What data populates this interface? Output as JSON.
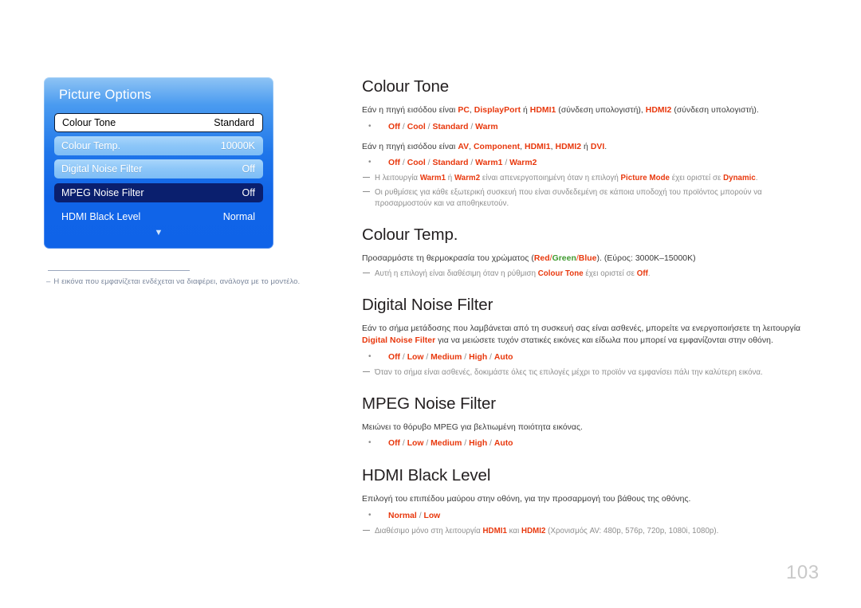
{
  "osd": {
    "title": "Picture Options",
    "scroll_down_icon": "chevron-down-icon",
    "rows": [
      {
        "label": "Colour Tone",
        "value": "Standard",
        "state": "selected"
      },
      {
        "label": "Colour Temp.",
        "value": "10000K",
        "state": "light"
      },
      {
        "label": "Digital Noise Filter",
        "value": "Off",
        "state": "light"
      },
      {
        "label": "MPEG Noise Filter",
        "value": "Off",
        "state": "dark"
      },
      {
        "label": "HDMI Black Level",
        "value": "Normal",
        "state": "plain"
      }
    ],
    "footnote_dash": "–",
    "footnote": "Η εικόνα που εμφανίζεται ενδέχεται να διαφέρει, ανάλογα με το μοντέλο."
  },
  "sections": {
    "colour_tone": {
      "title": "Colour Tone",
      "p1_a": "Εάν η πηγή εισόδου είναι ",
      "p1_pc": "PC",
      "p1_b": ", ",
      "p1_dp": "DisplayPort",
      "p1_c": " ή ",
      "p1_hdmi1": "HDMI1",
      "p1_d": " (σύνδεση υπολογιστή), ",
      "p1_hdmi2": "HDMI2",
      "p1_e": " (σύνδεση υπολογιστή).",
      "opts1": [
        "Off",
        "Cool",
        "Standard",
        "Warm"
      ],
      "p2_a": "Εάν η πηγή εισόδου είναι ",
      "p2_av": "AV",
      "p2_b": ", ",
      "p2_component": "Component",
      "p2_c": ", ",
      "p2_hdmi1": "HDMI1",
      "p2_d": ", ",
      "p2_hdmi2": "HDMI2",
      "p2_e": "  ή ",
      "p2_dvi": "DVI",
      "p2_f": ".",
      "opts2": [
        "Off",
        "Cool",
        "Standard",
        "Warm1",
        "Warm2"
      ],
      "note1_a": "Η λειτουργία ",
      "note1_warm1": "Warm1",
      "note1_b": " ή ",
      "note1_warm2": "Warm2",
      "note1_c": " είναι απενεργοποιημένη όταν η επιλογή ",
      "note1_pm": "Picture Mode",
      "note1_d": " έχει οριστεί σε ",
      "note1_dynamic": "Dynamic",
      "note1_e": ".",
      "note2": "Οι ρυθμίσεις για κάθε εξωτερική συσκευή που είναι συνδεδεμένη σε κάποια υποδοχή του προϊόντος μπορούν να προσαρμοστούν και να αποθηκευτούν."
    },
    "colour_temp": {
      "title": "Colour Temp.",
      "p1_a": "Προσαρμόστε τη θερμοκρασία του χρώματος (",
      "p1_red": "Red",
      "p1_sl1": "/",
      "p1_green": "Green",
      "p1_sl2": "/",
      "p1_blue": "Blue",
      "p1_b": "). (Εύρος: 3000K–15000K)",
      "note1_a": "Αυτή η επιλογή είναι διαθέσιμη όταν η ρύθμιση ",
      "note1_ct": "Colour Tone",
      "note1_b": " έχει οριστεί σε ",
      "note1_off": "Off",
      "note1_c": "."
    },
    "digital_noise_filter": {
      "title": "Digital Noise Filter",
      "p1_a": "Εάν το σήμα μετάδοσης που λαμβάνεται από τη συσκευή σας είναι ασθενές, μπορείτε να ενεργοποιήσετε τη λειτουργία ",
      "p1_dnf": "Digital Noise Filter",
      "p1_b": " για να μειώσετε τυχόν στατικές εικόνες και είδωλα που μπορεί να εμφανίζονται στην οθόνη.",
      "opts": [
        "Off",
        "Low",
        "Medium",
        "High",
        "Auto"
      ],
      "note1": "Όταν το σήμα είναι ασθενές, δοκιμάστε όλες τις επιλογές μέχρι το προϊόν να εμφανίσει πάλι την καλύτερη εικόνα."
    },
    "mpeg_noise_filter": {
      "title": "MPEG Noise Filter",
      "p1": "Μειώνει το θόρυβο MPEG για βελτιωμένη ποιότητα εικόνας.",
      "opts": [
        "Off",
        "Low",
        "Medium",
        "High",
        "Auto"
      ]
    },
    "hdmi_black_level": {
      "title": "HDMI Black Level",
      "p1": "Επιλογή του επιπέδου μαύρου στην οθόνη, για την προσαρμογή του βάθους της οθόνης.",
      "opts": [
        "Normal",
        "Low"
      ],
      "note1_a": "Διαθέσιμο μόνο στη λειτουργία ",
      "note1_hdmi1": "HDMI1",
      "note1_b": " και ",
      "note1_hdmi2": "HDMI2",
      "note1_c": " (Χρονισμός AV: 480p, 576p, 720p, 1080i, 1080p)."
    }
  },
  "page_number": "103",
  "colors": {
    "accent_red": "#e8380d",
    "accent_green": "#3f9a2f",
    "osd_blue": "#0f63e8",
    "osd_dark": "#0a1f6e",
    "muted": "#8d8d8d"
  }
}
